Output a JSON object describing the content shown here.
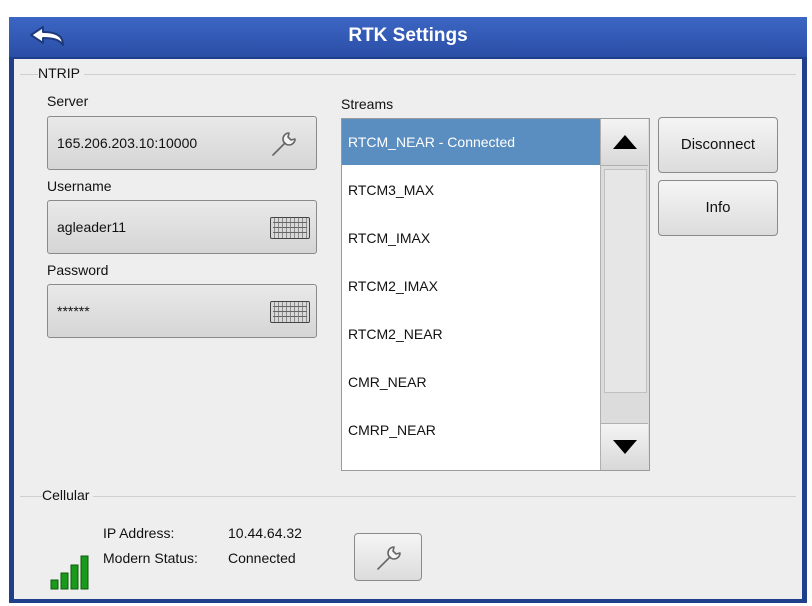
{
  "window": {
    "title": "RTK Settings"
  },
  "ntrip": {
    "section_label": "NTRIP",
    "server": {
      "label": "Server",
      "value": "165.206.203.10:10000"
    },
    "username": {
      "label": "Username",
      "value": "agleader11"
    },
    "password": {
      "label": "Password",
      "value": "******"
    }
  },
  "streams": {
    "label": "Streams",
    "items": [
      {
        "label": "RTCM_NEAR - Connected",
        "selected": true
      },
      {
        "label": "RTCM3_MAX",
        "selected": false
      },
      {
        "label": "RTCM_IMAX",
        "selected": false
      },
      {
        "label": "RTCM2_IMAX",
        "selected": false
      },
      {
        "label": "RTCM2_NEAR",
        "selected": false
      },
      {
        "label": "CMR_NEAR",
        "selected": false
      },
      {
        "label": "CMRP_NEAR",
        "selected": false
      }
    ]
  },
  "buttons": {
    "disconnect": "Disconnect",
    "info": "Info"
  },
  "cellular": {
    "section_label": "Cellular",
    "ip_label": "IP Address:",
    "ip_value": "10.44.64.32",
    "status_label": "Modern Status:",
    "status_value": "Connected"
  },
  "colors": {
    "title_bar": "#2a4ea6",
    "selected_row": "#5a8ec0",
    "signal": "#1a9a1a"
  }
}
